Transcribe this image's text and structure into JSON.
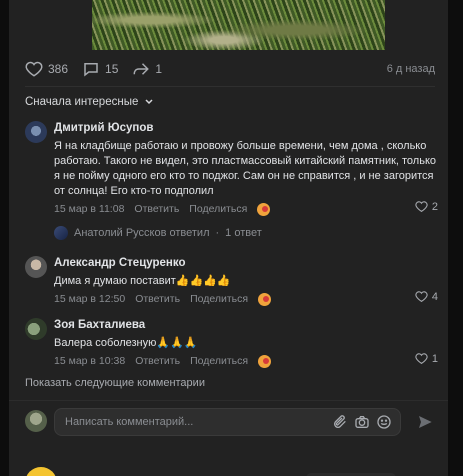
{
  "post": {
    "likes": "386",
    "comments": "15",
    "shares": "1",
    "time_ago": "6 д назад"
  },
  "sort_label": "Сначала интересные",
  "comments": [
    {
      "author": "Дмитрий Юсупов",
      "text": "Я на кладбище работаю и провожу больше времени, чем дома , сколько работаю. Такого не видел, это пластмассовый китайский памятник, только я не пойму одного его кто то поджог. Сам он не справится , и не загорится от солнца! Его кто-то подполил",
      "date": "15 мар в 11:08",
      "reply": "Ответить",
      "share": "Поделиться",
      "likes": "2"
    },
    {
      "author": "Александр Стецуренко",
      "text": "Дима я думаю поставит👍👍👍👍",
      "date": "15 мар в 12:50",
      "reply": "Ответить",
      "share": "Поделиться",
      "likes": "4"
    },
    {
      "author": "Зоя Бахталиева",
      "text": "Валера соболезную🙏🙏🙏",
      "date": "15 мар в 10:38",
      "reply": "Ответить",
      "share": "Поделиться",
      "likes": "1"
    }
  ],
  "reply_thread": {
    "author_replied": "Анатолий Русcков ответил",
    "sep": "·",
    "count": "1 ответ"
  },
  "show_more": "Показать следующие комментарии",
  "compose_placeholder": "Написать комментарий...",
  "colors": {
    "accent": "#e1e3e6",
    "muted": "#8a8d92"
  }
}
